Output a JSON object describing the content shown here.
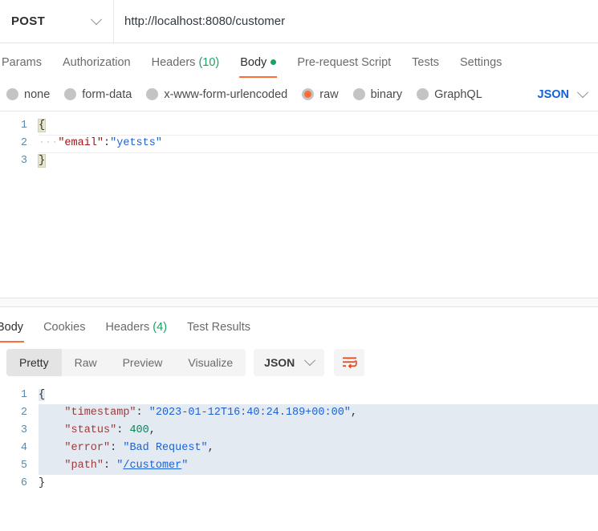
{
  "request_bar": {
    "method": "POST",
    "method_icon": "chevron-down-icon",
    "url": "http://localhost:8080/customer"
  },
  "request_tabs": [
    {
      "label": "Params",
      "active": false
    },
    {
      "label": "Authorization",
      "active": false
    },
    {
      "label": "Headers",
      "count": "(10)",
      "active": false
    },
    {
      "label": "Body",
      "active": true,
      "dot": true
    },
    {
      "label": "Pre-request Script",
      "active": false
    },
    {
      "label": "Tests",
      "active": false
    },
    {
      "label": "Settings",
      "active": false
    }
  ],
  "body_types": [
    {
      "label": "none",
      "selected": false
    },
    {
      "label": "form-data",
      "selected": false
    },
    {
      "label": "x-www-form-urlencoded",
      "selected": false
    },
    {
      "label": "raw",
      "selected": true
    },
    {
      "label": "binary",
      "selected": false
    },
    {
      "label": "GraphQL",
      "selected": false
    }
  ],
  "body_format": {
    "label": "JSON",
    "icon": "chevron-down-icon"
  },
  "request_body": {
    "lines": [
      {
        "num": "1",
        "open_brace": "{"
      },
      {
        "num": "2",
        "indent": "···",
        "key": "\"email\"",
        "colon": ":",
        "value": "\"yetsts\""
      },
      {
        "num": "3",
        "close_brace": "}"
      }
    ]
  },
  "response_tabs": [
    {
      "label": "Body",
      "active": true
    },
    {
      "label": "Cookies",
      "active": false
    },
    {
      "label": "Headers",
      "count": "(4)",
      "active": false
    },
    {
      "label": "Test Results",
      "active": false
    }
  ],
  "response_toolbar": {
    "segments": [
      {
        "label": "Pretty",
        "active": true
      },
      {
        "label": "Raw",
        "active": false
      },
      {
        "label": "Preview",
        "active": false
      },
      {
        "label": "Visualize",
        "active": false
      }
    ],
    "format": {
      "label": "JSON",
      "icon": "chevron-down-icon"
    },
    "wrap_button_icon": "word-wrap-icon"
  },
  "response_body": {
    "lines": [
      {
        "num": "1",
        "open_brace": "{"
      },
      {
        "num": "2",
        "key": "\"timestamp\"",
        "colon": ":",
        "value": "\"2023-01-12T16:40:24.189+00:00\"",
        "comma": ","
      },
      {
        "num": "3",
        "key": "\"status\"",
        "colon": ":",
        "number": "400",
        "comma": ","
      },
      {
        "num": "4",
        "key": "\"error\"",
        "colon": ":",
        "value": "\"Bad Request\"",
        "comma": ","
      },
      {
        "num": "5",
        "key": "\"path\"",
        "colon": ":",
        "quote_open": "\"",
        "link": "/customer",
        "quote_close": "\""
      },
      {
        "num": "6",
        "close_brace": "}"
      }
    ]
  },
  "colors": {
    "accent": "#ff6c37",
    "green": "#1aa260",
    "link_blue": "#1062d6",
    "string_blue": "#1c62d6",
    "key_red": "#a31515",
    "number_green": "#098658",
    "selection": "#e4eaf2"
  }
}
